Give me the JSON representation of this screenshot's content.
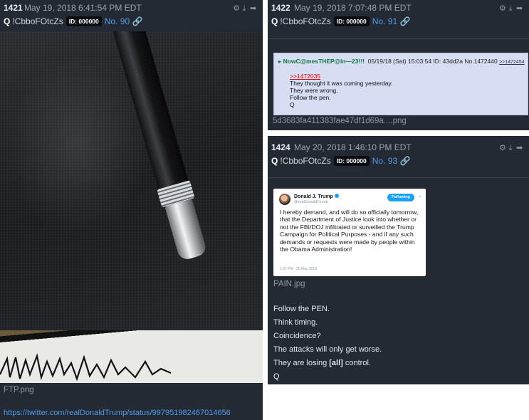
{
  "post_1421": {
    "number": "1421",
    "date": "May 19, 2018 6:41:54 PM EDT",
    "q": "Q",
    "trip": "!CbboFOtcZs",
    "id": "ID: 000000",
    "no": "No. 90",
    "filename": "FTP.png",
    "link": "https://twitter.com/realDonaldTrump/status/997951982467014656"
  },
  "post_1422": {
    "number": "1422",
    "date": "May 19, 2018 7:07:48 PM EDT",
    "q": "Q",
    "trip": "!CbboFOtcZs",
    "id": "ID: 000000",
    "no": "No. 91",
    "filename": "5d3683fa411383fae47df1d69a....png",
    "screenshot": {
      "name": "NowC@mesTHEP@in—23!!!",
      "meta": "05/19/18 (Sat) 15:03:54 ID: 43dd2a No.1472440",
      "reply": ">>1472454",
      "quote": ">>1472035",
      "lines": [
        "They thought it was coming yesterday.",
        "They were wrong.",
        "Follow the pen.",
        "Q"
      ]
    }
  },
  "post_1424": {
    "number": "1424",
    "date": "May 20, 2018 1:46:10 PM EDT",
    "q": "Q",
    "trip": "!CbboFOtcZs",
    "id": "ID: 000000",
    "no": "No. 93",
    "filename": "PAIN.jpg",
    "tweet": {
      "name": "Donald J. Trump",
      "handle": "@realDonaldTrump",
      "follow": "Following",
      "text": "I hereby demand, and will do so officially tomorrow, that the Department of Justice look into whether or not the FBI/DOJ infiltrated or surveilled the Trump Campaign for Political Purposes - and if any such demands or requests were made by people within the Obama Administration!",
      "time": "1:37 PM - 20 May 2018"
    },
    "lines": [
      "Follow the PEN.",
      "Think timing.",
      "Coincidence?",
      "The attacks will only get worse."
    ],
    "line5_before": "They are losing ",
    "line5_bold": "[all]",
    "line5_after": " control.",
    "sign": "Q"
  },
  "icons": [
    "share-icon",
    "download-icon",
    "arrow-right-icon",
    "link-icon"
  ],
  "colors": {
    "post_bg": "#232a33",
    "link": "#4d9bea",
    "greentext_name": "#117743",
    "quote_ref": "#dd0000"
  }
}
